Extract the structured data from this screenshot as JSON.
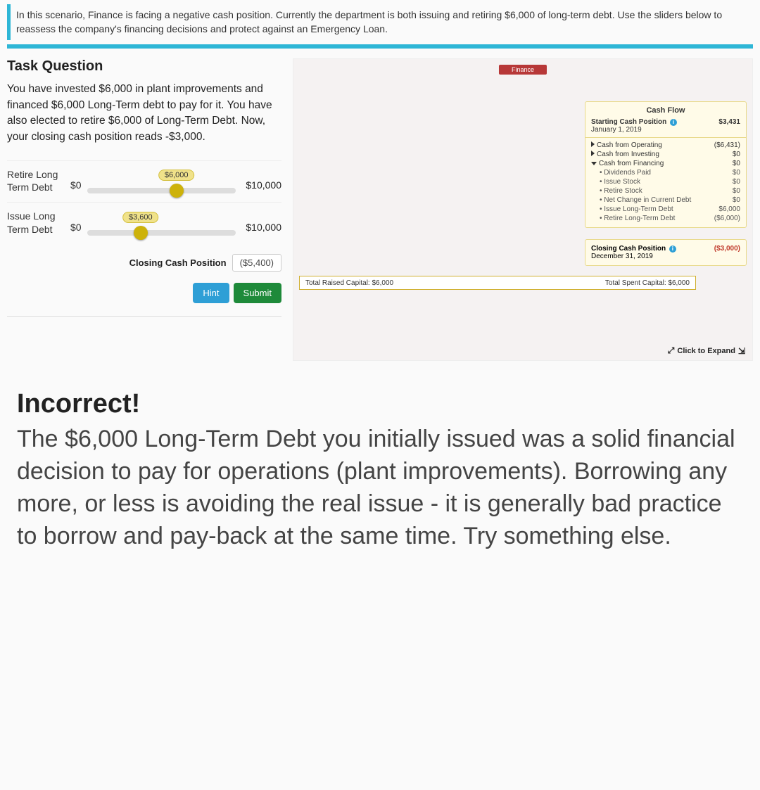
{
  "banner": {
    "text": "In this scenario, Finance is facing a negative cash position. Currently the department is both issuing and retiring $6,000 of long-term debt. Use the sliders below to reassess the company's financing decisions and protect against an Emergency Loan."
  },
  "task": {
    "heading": "Task Question",
    "body": "You have invested $6,000 in plant improvements and financed $6,000 Long-Term debt to pay for it. You have also elected to retire $6,000 of Long-Term Debt. Now, your closing cash position reads -$3,000."
  },
  "sliders": {
    "retire": {
      "label": "Retire Long Term Debt",
      "min": "$0",
      "max": "$10,000",
      "value_label": "$6,000",
      "pos_pct": 60
    },
    "issue": {
      "label": "Issue Long Term Debt",
      "min": "$0",
      "max": "$10,000",
      "value_label": "$3,600",
      "pos_pct": 36
    }
  },
  "closing_cash": {
    "label": "Closing Cash Position",
    "value": "($5,400)"
  },
  "buttons": {
    "hint": "Hint",
    "submit": "Submit"
  },
  "cashflow": {
    "title": "Cash Flow",
    "start_label": "Starting Cash Position",
    "start_date": "January 1, 2019",
    "start_value": "$3,431",
    "lines": [
      {
        "label": "Cash from Operating",
        "value": "($6,431)",
        "caret": "right"
      },
      {
        "label": "Cash from Investing",
        "value": "$0",
        "caret": "right"
      },
      {
        "label": "Cash from Financing",
        "value": "$0",
        "caret": "down"
      }
    ],
    "subs": [
      {
        "label": "Dividends Paid",
        "value": "$0"
      },
      {
        "label": "Issue Stock",
        "value": "$0"
      },
      {
        "label": "Retire Stock",
        "value": "$0"
      },
      {
        "label": "Net Change in Current Debt",
        "value": "$0"
      },
      {
        "label": "Issue Long-Term Debt",
        "value": "$6,000"
      },
      {
        "label": "Retire Long-Term Debt",
        "value": "($6,000)"
      }
    ],
    "close_label": "Closing Cash Position",
    "close_date": "December 31, 2019",
    "close_value": "($3,000)"
  },
  "totals": {
    "raised": "Total Raised Capital: $6,000",
    "spent": "Total Spent Capital: $6,000"
  },
  "expand": "Click to Expand",
  "finance_tab": "Finance",
  "feedback": {
    "heading": "Incorrect!",
    "body": "The $6,000 Long-Term Debt you initially issued was a solid financial decision to pay for operations (plant improvements). Borrowing any more, or less is avoiding the real issue - it is generally bad practice to borrow and pay-back at the same time. Try something else."
  }
}
